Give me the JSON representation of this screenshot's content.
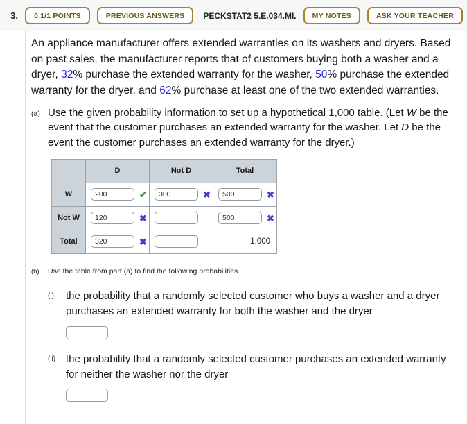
{
  "toolbar": {
    "question_number": "3.",
    "points_label": "0.1/1 POINTS",
    "previous_answers_label": "PREVIOUS ANSWERS",
    "problem_id": "PECKSTAT2 5.E.034.MI.",
    "my_notes_label": "MY NOTES",
    "ask_teacher_label": "ASK YOUR TEACHER",
    "accent_border": "#a3832c",
    "accent_text": "#6b5414"
  },
  "problem": {
    "intro_1": "An appliance manufacturer offers extended warranties on its washers and dryers. Based on past sales, the manufacturer reports that of customers buying both a washer and a dryer, ",
    "pct_washer": "32",
    "intro_2": "% purchase the extended warranty for the washer, ",
    "pct_dryer": "50",
    "intro_3": "% purchase the extended warranty for the dryer, and ",
    "pct_atleast": "62",
    "intro_4": "% purchase at least one of the two extended warranties.",
    "highlight_color": "#2b2bd4"
  },
  "part_a": {
    "label": "(a)",
    "text_1": "Use the given probability information to set up a hypothetical 1,000 table. (Let ",
    "var_w": "W",
    "text_2": " be the event that the customer purchases an extended warranty for the washer. Let ",
    "var_d": "D",
    "text_3": " be the event the customer purchases an extended warranty for the dryer.)"
  },
  "table": {
    "column_headers": [
      "",
      "D",
      "Not D",
      "Total"
    ],
    "row_headers": [
      "W",
      "Not W",
      "Total"
    ],
    "rows": [
      {
        "header": "W",
        "cells": [
          {
            "type": "input",
            "value": "200",
            "mark": "correct"
          },
          {
            "type": "input",
            "value": "300",
            "mark": "incorrect"
          },
          {
            "type": "input",
            "value": "500",
            "mark": "incorrect"
          }
        ]
      },
      {
        "header": "Not W",
        "cells": [
          {
            "type": "input",
            "value": "120",
            "mark": "incorrect"
          },
          {
            "type": "input",
            "value": "",
            "mark": "none"
          },
          {
            "type": "input",
            "value": "500",
            "mark": "incorrect"
          }
        ]
      },
      {
        "header": "Total",
        "cells": [
          {
            "type": "input",
            "value": "320",
            "mark": "incorrect"
          },
          {
            "type": "input",
            "value": "",
            "mark": "none"
          },
          {
            "type": "static",
            "value": "1,000"
          }
        ]
      }
    ],
    "header_bg": "#ccd4da",
    "border_color": "#9aa2aa",
    "correct_color": "#2e9c38",
    "incorrect_color": "#4040cf",
    "correct_glyph": "✔",
    "incorrect_glyph": "✖"
  },
  "part_b": {
    "label": "(b)",
    "text": "Use the table from part (a) to find the following probabilities.",
    "items": [
      {
        "label": "(i)",
        "text": "the probability that a randomly selected customer who buys a washer and a dryer purchases an extended warranty for both the washer and the dryer",
        "answer": ""
      },
      {
        "label": "(ii)",
        "text": "the probability that a randomly selected customer purchases an extended warranty for neither the washer nor the dryer",
        "answer": ""
      }
    ]
  }
}
